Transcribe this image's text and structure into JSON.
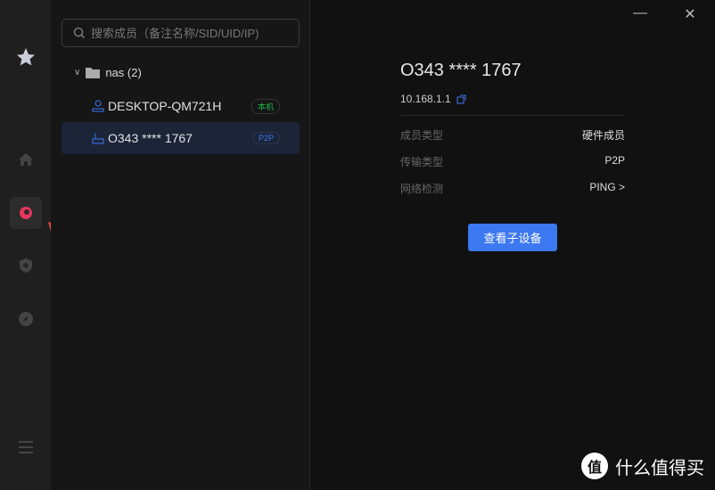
{
  "search": {
    "placeholder": "搜索成员（备注名称/SID/UID/IP)"
  },
  "group": {
    "label": "nas (2)"
  },
  "members": [
    {
      "name": "DESKTOP-QM721H",
      "badge": "本机",
      "badge_color": "#1fb84a",
      "icon": "user-icon"
    },
    {
      "name": "O343 **** 1767",
      "badge": "P2P",
      "badge_color": "#3c78f0",
      "icon": "router-icon"
    }
  ],
  "detail": {
    "title": "O343 **** 1767",
    "ip": "10.168.1.1",
    "rows": [
      {
        "key": "成员类型",
        "value": "硬件成员"
      },
      {
        "key": "传输类型",
        "value": "P2P"
      },
      {
        "key": "网络检测",
        "value": "PING >"
      }
    ],
    "button": "查看子设备"
  },
  "window": {
    "minimize": "—",
    "close": "✕"
  },
  "watermark": {
    "logo": "值",
    "text": "什么值得买"
  },
  "accent": "#3c78f0",
  "active_color": "#e8365d"
}
